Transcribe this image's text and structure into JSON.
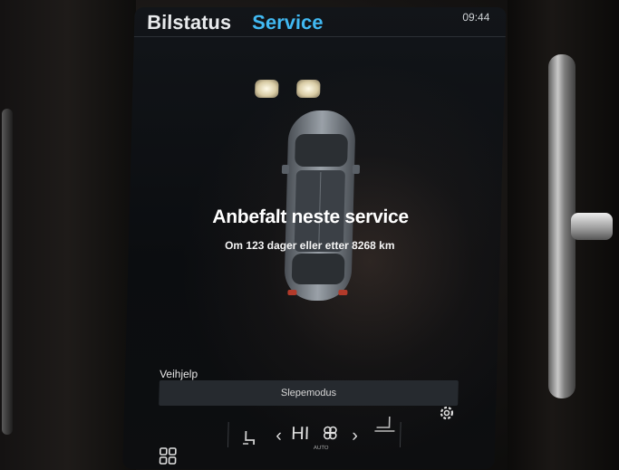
{
  "header": {
    "tab_car_status": "Bilstatus",
    "tab_service": "Service",
    "status_time": "09:44"
  },
  "service": {
    "title": "Anbefalt neste service",
    "subtitle": "Om 123 dager eller etter 8268 km"
  },
  "roadside": {
    "section_label": "Veihjelp",
    "tow_mode_button": "Slepemodus"
  },
  "climate": {
    "temperature_label": "HI",
    "auto_label": "AUTO"
  },
  "colors": {
    "accent": "#41b9f2",
    "screen_background": "#0b0d10"
  },
  "icons": [
    "grid-icon",
    "seat-heat-icon",
    "chevron-left-icon",
    "fan-icon",
    "chevron-right-icon",
    "seat-icon",
    "gear-icon"
  ]
}
